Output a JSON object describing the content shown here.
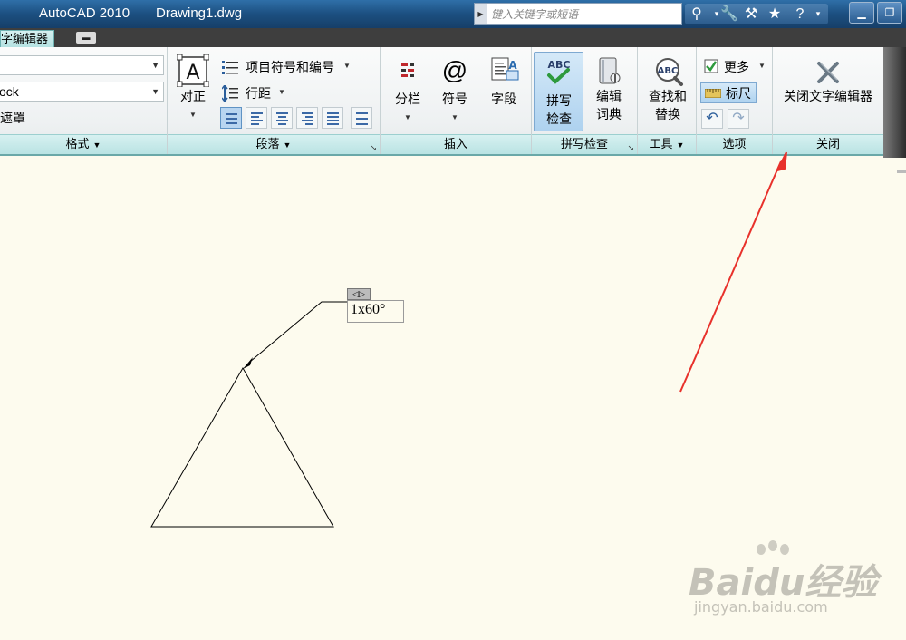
{
  "titlebar": {
    "app": "AutoCAD 2010",
    "file": "Drawing1.dwg",
    "search_placeholder": "键入关键字或短语"
  },
  "context_tab": {
    "label": "文字编辑器"
  },
  "ribbon": {
    "format": {
      "font_value": "",
      "color_value": "ock",
      "mask_label": "遮罩",
      "footer": "格式"
    },
    "paragraph": {
      "justify_label": "对正",
      "bullets_label": "项目符号和编号",
      "line_spacing_label": "行距",
      "footer": "段落"
    },
    "insert": {
      "columns_label": "分栏",
      "symbol_label": "符号",
      "field_label": "字段",
      "footer": "插入"
    },
    "spell": {
      "spell_check_line1": "拼写",
      "spell_check_line2": "检查",
      "dictionary_line1": "编辑",
      "dictionary_line2": "词典",
      "footer": "拼写检查"
    },
    "tools": {
      "find_line1": "查找和",
      "find_line2": "替换",
      "footer": "工具"
    },
    "options": {
      "more_label": "更多",
      "ruler_label": "标尺",
      "footer": "选项"
    },
    "close": {
      "close_label": "关闭文字编辑器",
      "footer": "关闭"
    }
  },
  "canvas": {
    "mtext": "1x60°"
  },
  "watermark": {
    "main": "Baidu经验",
    "sub": "jingyan.baidu.com"
  },
  "colors": {
    "canvas_bg": "#fdfbee",
    "annotation_arrow": "#e8312b",
    "ribbon_footer": "#c4e8e8"
  }
}
